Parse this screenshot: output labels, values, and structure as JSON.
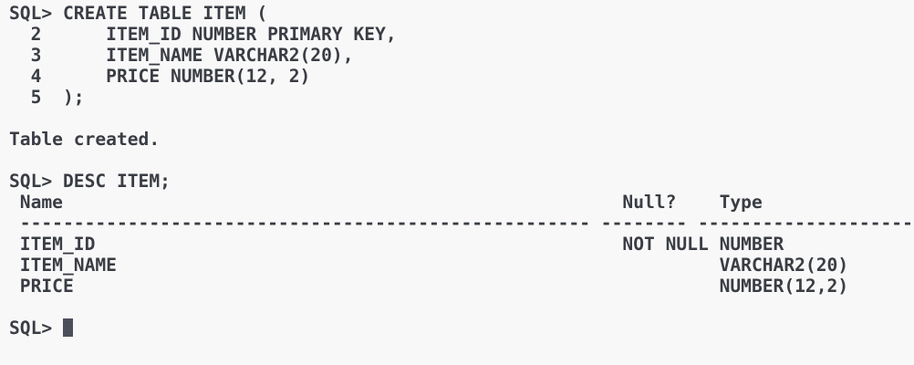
{
  "terminal": {
    "create_command": "SQL> CREATE TABLE ITEM (",
    "line2": "  2      ITEM_ID NUMBER PRIMARY KEY,",
    "line3": "  3      ITEM_NAME VARCHAR2(20),",
    "line4": "  4      PRICE NUMBER(12, 2)",
    "line5": "  5  );",
    "create_result": "Table created.",
    "desc_command": "SQL> DESC ITEM;",
    "desc_header": " Name                                                    Null?    Type",
    "desc_separator": " ----------------------------------------------------- -------- ----------------------------",
    "desc_rows": [
      " ITEM_ID                                                 NOT NULL NUMBER",
      " ITEM_NAME                                                        VARCHAR2(20)",
      " PRICE                                                            NUMBER(12,2)"
    ],
    "prompt": "SQL> "
  },
  "colors": {
    "background": "#f8f8f8",
    "foreground": "#3a3d44",
    "cursor": "#4b4f5a"
  }
}
